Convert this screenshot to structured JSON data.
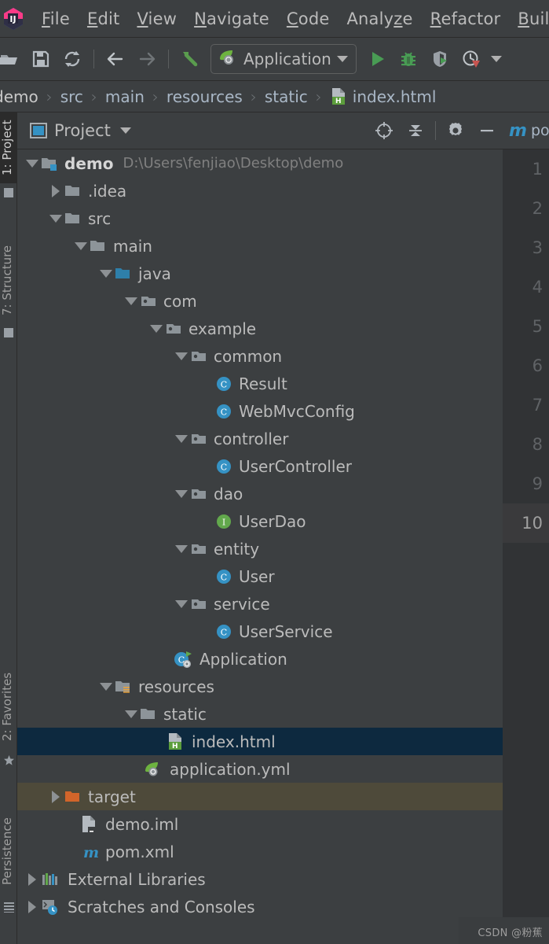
{
  "app": {
    "logo_icon": "intellij-idea-logo",
    "watermark": "CSDN @粉蕉"
  },
  "menubar": {
    "items": [
      {
        "label": "File",
        "mnemonic_index": 0
      },
      {
        "label": "Edit",
        "mnemonic_index": 0
      },
      {
        "label": "View",
        "mnemonic_index": 0
      },
      {
        "label": "Navigate",
        "mnemonic_index": 0
      },
      {
        "label": "Code",
        "mnemonic_index": 0
      },
      {
        "label": "Analyze",
        "mnemonic_index": 5
      },
      {
        "label": "Refactor",
        "mnemonic_index": 0
      },
      {
        "label": "Build",
        "mnemonic_index": 0
      }
    ]
  },
  "toolbar": {
    "buttons": [
      {
        "name": "open-folder-icon",
        "tooltip": "Open"
      },
      {
        "name": "save-all-icon",
        "tooltip": "Save All"
      },
      {
        "name": "sync-refresh-icon",
        "tooltip": "Synchronize"
      },
      {
        "name": "back-arrow-icon",
        "tooltip": "Back"
      },
      {
        "name": "forward-arrow-icon",
        "tooltip": "Forward"
      },
      {
        "name": "build-hammer-icon",
        "tooltip": "Build Project"
      }
    ],
    "run_config": {
      "icon": "spring-boot-leaf-icon",
      "label": "Application",
      "dropdown_icon": "chevron-down-icon"
    },
    "run_buttons": [
      {
        "name": "run-icon",
        "tooltip": "Run",
        "color": "#499c54"
      },
      {
        "name": "debug-bug-icon",
        "tooltip": "Debug",
        "color": "#499c54"
      },
      {
        "name": "run-with-coverage-icon",
        "tooltip": "Run with Coverage"
      },
      {
        "name": "profiler-icon",
        "tooltip": "Profile"
      },
      {
        "name": "chevron-down-icon",
        "tooltip": "More"
      }
    ]
  },
  "breadcrumb": {
    "items": [
      "demo",
      "src",
      "main",
      "resources",
      "static"
    ],
    "separator": "›",
    "file": {
      "label": "index.html",
      "icon": "html-file-icon"
    }
  },
  "left_tabs": [
    {
      "label": "1: Project",
      "active": true,
      "icon": "project-icon"
    },
    {
      "label": "7: Structure",
      "active": false,
      "icon": "structure-icon"
    },
    {
      "label": "2: Favorites",
      "active": false,
      "icon": "star-icon"
    },
    {
      "label": "Persistence",
      "active": false,
      "icon": "persistence-icon"
    }
  ],
  "project_panel": {
    "title": "Project",
    "title_icon": "project-view-icon",
    "dropdown_icon": "chevron-down-icon",
    "actions": [
      {
        "name": "locate-target-icon",
        "tooltip": "Select Opened File"
      },
      {
        "name": "collapse-all-icon",
        "tooltip": "Collapse All"
      },
      {
        "name": "settings-gear-icon",
        "tooltip": "Settings"
      },
      {
        "name": "hide-minus-icon",
        "tooltip": "Hide"
      }
    ]
  },
  "tree": {
    "rows": [
      {
        "indent": 0,
        "twist": "down",
        "icon": "module-folder-icon",
        "label": "demo",
        "bold": true,
        "path": "D:\\Users\\fenjiao\\Desktop\\demo",
        "state": "normal"
      },
      {
        "indent": 1,
        "twist": "right",
        "icon": "folder-icon",
        "label": ".idea",
        "state": "normal"
      },
      {
        "indent": 1,
        "twist": "down",
        "icon": "folder-icon",
        "label": "src",
        "state": "normal"
      },
      {
        "indent": 2,
        "twist": "down",
        "icon": "folder-icon",
        "label": "main",
        "state": "normal"
      },
      {
        "indent": 3,
        "twist": "down",
        "icon": "source-folder-icon",
        "label": "java",
        "state": "normal"
      },
      {
        "indent": 4,
        "twist": "down",
        "icon": "package-icon",
        "label": "com",
        "state": "normal"
      },
      {
        "indent": 5,
        "twist": "down",
        "icon": "package-icon",
        "label": "example",
        "state": "normal"
      },
      {
        "indent": 6,
        "twist": "down",
        "icon": "package-icon",
        "label": "common",
        "state": "normal"
      },
      {
        "indent": 7,
        "twist": "none",
        "icon": "java-class-icon",
        "label": "Result",
        "state": "normal"
      },
      {
        "indent": 7,
        "twist": "none",
        "icon": "java-class-icon",
        "label": "WebMvcConfig",
        "state": "normal"
      },
      {
        "indent": 6,
        "twist": "down",
        "icon": "package-icon",
        "label": "controller",
        "state": "normal"
      },
      {
        "indent": 7,
        "twist": "none",
        "icon": "java-class-icon",
        "label": "UserController",
        "state": "normal"
      },
      {
        "indent": 6,
        "twist": "down",
        "icon": "package-icon",
        "label": "dao",
        "state": "normal"
      },
      {
        "indent": 7,
        "twist": "none",
        "icon": "java-interface-icon",
        "label": "UserDao",
        "state": "normal"
      },
      {
        "indent": 6,
        "twist": "down",
        "icon": "package-icon",
        "label": "entity",
        "state": "normal"
      },
      {
        "indent": 7,
        "twist": "none",
        "icon": "java-class-icon",
        "label": "User",
        "state": "normal"
      },
      {
        "indent": 6,
        "twist": "down",
        "icon": "package-icon",
        "label": "service",
        "state": "normal"
      },
      {
        "indent": 7,
        "twist": "none",
        "icon": "java-class-icon",
        "label": "UserService",
        "state": "normal"
      },
      {
        "indent": 6,
        "twist": "none",
        "icon": "spring-boot-app-icon",
        "label": "Application",
        "state": "normal"
      },
      {
        "indent": 3,
        "twist": "down",
        "icon": "resources-folder-icon",
        "label": "resources",
        "state": "normal"
      },
      {
        "indent": 4,
        "twist": "down",
        "icon": "folder-icon",
        "label": "static",
        "state": "normal"
      },
      {
        "indent": 5,
        "twist": "none",
        "icon": "html-file-icon",
        "label": "index.html",
        "state": "selected"
      },
      {
        "indent": 4,
        "twist": "none",
        "icon": "spring-yml-icon",
        "label": "application.yml",
        "state": "normal"
      },
      {
        "indent": 1,
        "twist": "right",
        "icon": "excluded-folder-icon",
        "label": "target",
        "state": "excluded"
      },
      {
        "indent": 1,
        "twist": "none",
        "icon": "iml-file-icon",
        "label": "demo.iml",
        "state": "normal"
      },
      {
        "indent": 1,
        "twist": "none",
        "icon": "maven-pom-icon",
        "label": "pom.xml",
        "state": "normal"
      },
      {
        "indent": 0,
        "twist": "right",
        "icon": "external-libraries-icon",
        "label": "External Libraries",
        "state": "normal"
      },
      {
        "indent": 0,
        "twist": "right",
        "icon": "scratches-icon",
        "label": "Scratches and Consoles",
        "state": "normal"
      }
    ]
  },
  "editor": {
    "tab": {
      "icon": "maven-pom-icon",
      "label": "pom.xml"
    },
    "line_numbers": [
      "1",
      "2",
      "3",
      "4",
      "5",
      "6",
      "7",
      "8",
      "9",
      "10"
    ],
    "current_line": "10"
  },
  "colors": {
    "background": "#3c3f41",
    "editor_background": "#2b2b2b",
    "gutter_background": "#313335",
    "selection": "#0d293f",
    "excluded_row": "#4e4a3a",
    "text": "#bbbbbb",
    "accent_blue": "#3592c4",
    "accent_green": "#499c54",
    "folder_gray": "#8d9499",
    "source_folder_blue": "#2e7faa",
    "excluded_orange": "#d2652a"
  }
}
